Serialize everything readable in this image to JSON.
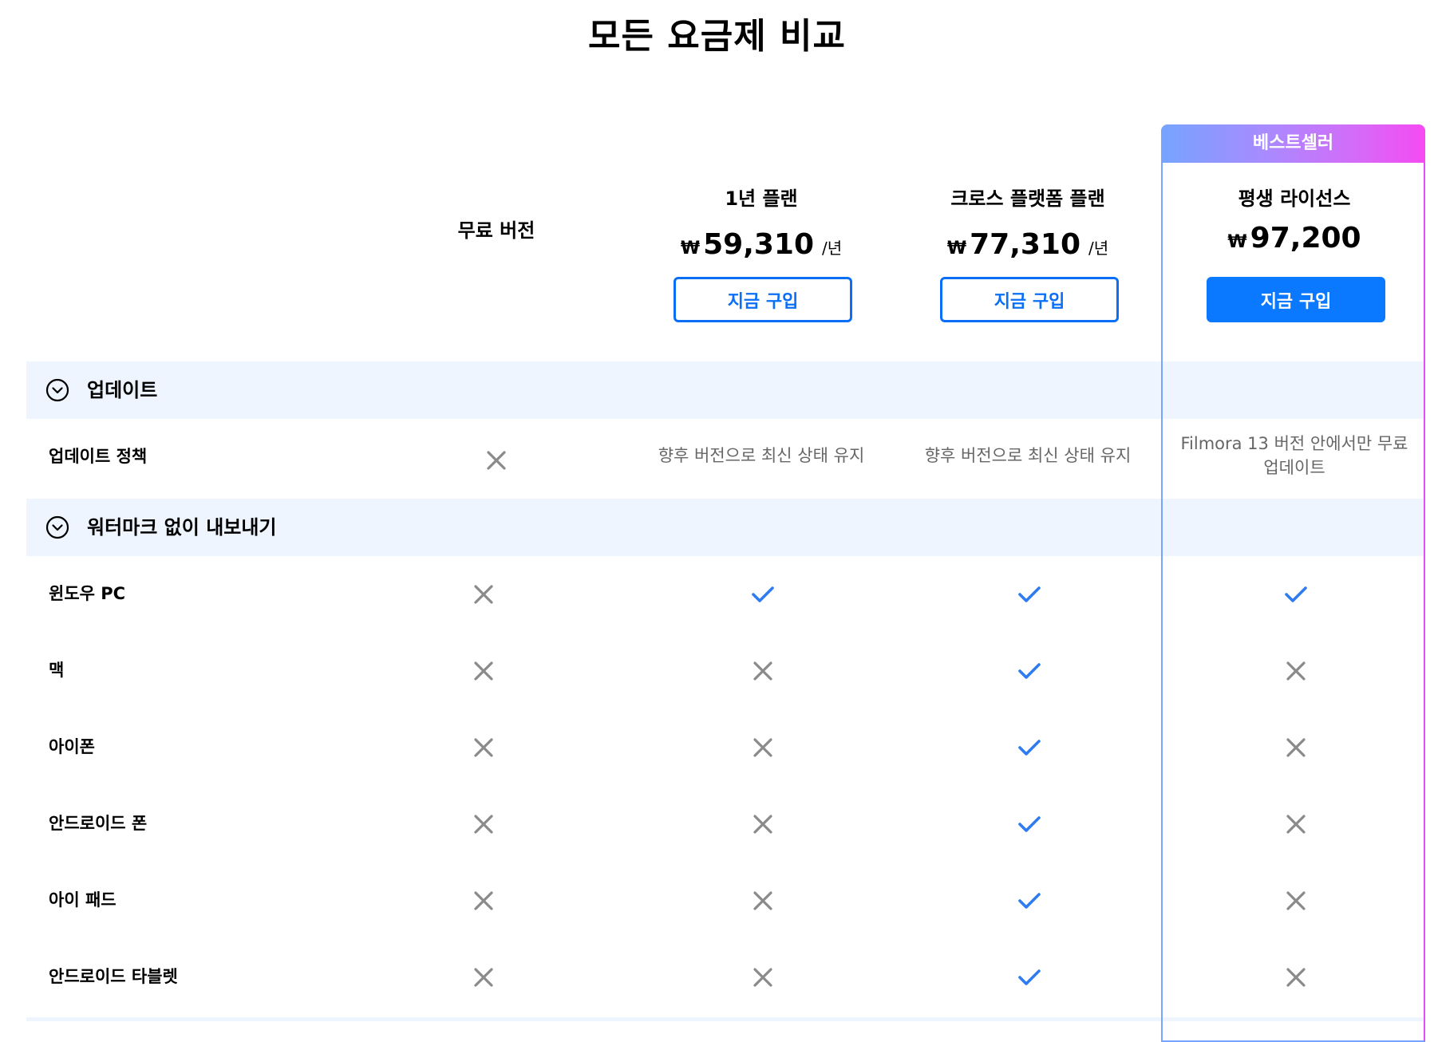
{
  "title": "모든 요금제 비교",
  "badge": "베스트셀러",
  "plans": [
    {
      "name": "무료 버전"
    },
    {
      "name": "1년 플랜",
      "currency": "₩",
      "price": "59,310",
      "unit": "/년",
      "button": "지금 구입"
    },
    {
      "name": "크로스 플랫폼 플랜",
      "currency": "₩",
      "price": "77,310",
      "unit": "/년",
      "button": "지금 구입"
    },
    {
      "name": "평생 라이선스",
      "currency": "₩",
      "price": "97,200",
      "button": "지금 구입"
    }
  ],
  "sections": [
    {
      "title": "업데이트",
      "toggle_icon": "chevron-down-circle-icon",
      "rows": [
        {
          "label": "업데이트 정책",
          "cells": [
            {
              "type": "cross"
            },
            {
              "type": "text",
              "text": "향후 버전으로 최신 상태 유지"
            },
            {
              "type": "text",
              "text": "향후 버전으로 최신 상태 유지"
            },
            {
              "type": "text",
              "line1": "Filmora 13 버전 안에서만 무료",
              "line2": "업데이트"
            }
          ]
        }
      ]
    },
    {
      "title": "워터마크 없이 내보내기",
      "toggle_icon": "chevron-down-circle-icon",
      "rows": [
        {
          "label": "윈도우 PC",
          "values": [
            "cross",
            "check",
            "check",
            "check"
          ]
        },
        {
          "label": "맥",
          "values": [
            "cross",
            "cross",
            "check",
            "cross"
          ]
        },
        {
          "label": "아이폰",
          "values": [
            "cross",
            "cross",
            "check",
            "cross"
          ]
        },
        {
          "label": "안드로이드 폰",
          "values": [
            "cross",
            "cross",
            "check",
            "cross"
          ]
        },
        {
          "label": "아이 패드",
          "values": [
            "cross",
            "cross",
            "check",
            "cross"
          ]
        },
        {
          "label": "안드로이드 타블렛",
          "values": [
            "cross",
            "cross",
            "check",
            "cross"
          ]
        }
      ]
    }
  ],
  "colors": {
    "accent": "#0a78ff",
    "check": "#2f7cf0",
    "cross": "#8a8a8a",
    "section_bg": "#eef5ff",
    "badge_gradient_start": "#76a4ff",
    "badge_gradient_end": "#f54af2"
  }
}
